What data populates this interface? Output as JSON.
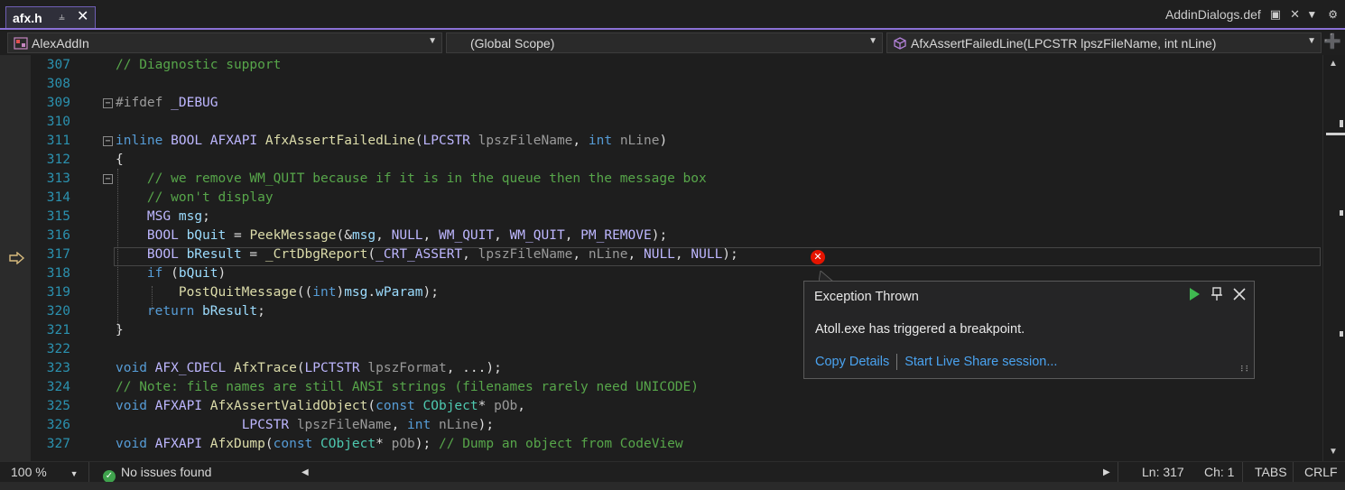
{
  "tabs": {
    "active": {
      "label": "afx.h",
      "pin_icon": "pin-icon",
      "close_icon": "close-icon"
    },
    "other": {
      "label": "AddinDialogs.def"
    }
  },
  "navbar": {
    "project": "AlexAddIn",
    "scope": "(Global Scope)",
    "member": "AfxAssertFailedLine(LPCSTR lpszFileName, int nLine)"
  },
  "editor": {
    "current_line": 317,
    "lines": [
      {
        "n": "307",
        "text": "// Diagnostic support"
      },
      {
        "n": "308",
        "text": ""
      },
      {
        "n": "309",
        "text": "#ifdef _DEBUG"
      },
      {
        "n": "310",
        "text": ""
      },
      {
        "n": "311",
        "text": "inline BOOL AFXAPI AfxAssertFailedLine(LPCSTR lpszFileName, int nLine)"
      },
      {
        "n": "312",
        "text": "{"
      },
      {
        "n": "313",
        "text": "    // we remove WM_QUIT because if it is in the queue then the message box"
      },
      {
        "n": "314",
        "text": "    // won't display"
      },
      {
        "n": "315",
        "text": "    MSG msg;"
      },
      {
        "n": "316",
        "text": "    BOOL bQuit = PeekMessage(&msg, NULL, WM_QUIT, WM_QUIT, PM_REMOVE);"
      },
      {
        "n": "317",
        "text": "    BOOL bResult = _CrtDbgReport(_CRT_ASSERT, lpszFileName, nLine, NULL, NULL);"
      },
      {
        "n": "318",
        "text": "    if (bQuit)"
      },
      {
        "n": "319",
        "text": "        PostQuitMessage((int)msg.wParam);"
      },
      {
        "n": "320",
        "text": "    return bResult;"
      },
      {
        "n": "321",
        "text": "}"
      },
      {
        "n": "322",
        "text": ""
      },
      {
        "n": "323",
        "text": "void AFX_CDECL AfxTrace(LPCTSTR lpszFormat, ...);"
      },
      {
        "n": "324",
        "text": "// Note: file names are still ANSI strings (filenames rarely need UNICODE)"
      },
      {
        "n": "325",
        "text": "void AFXAPI AfxAssertValidObject(const CObject* pOb,"
      },
      {
        "n": "326",
        "text": "                LPCSTR lpszFileName, int nLine);"
      },
      {
        "n": "327",
        "text": "void AFXAPI AfxDump(const CObject* pOb); // Dump an object from CodeView"
      }
    ]
  },
  "popup": {
    "title": "Exception Thrown",
    "message": "Atoll.exe has triggered a breakpoint.",
    "copy_details": "Copy Details",
    "live_share": "Start Live Share session..."
  },
  "statusbar": {
    "zoom": "100 %",
    "issues": "No issues found",
    "line": "Ln: 317",
    "col": "Ch: 1",
    "indent": "TABS",
    "eol": "CRLF"
  },
  "colors": {
    "accent": "#8a70d6",
    "error": "#e51400",
    "link": "#4aa3f0",
    "ok": "#3fa34d"
  }
}
